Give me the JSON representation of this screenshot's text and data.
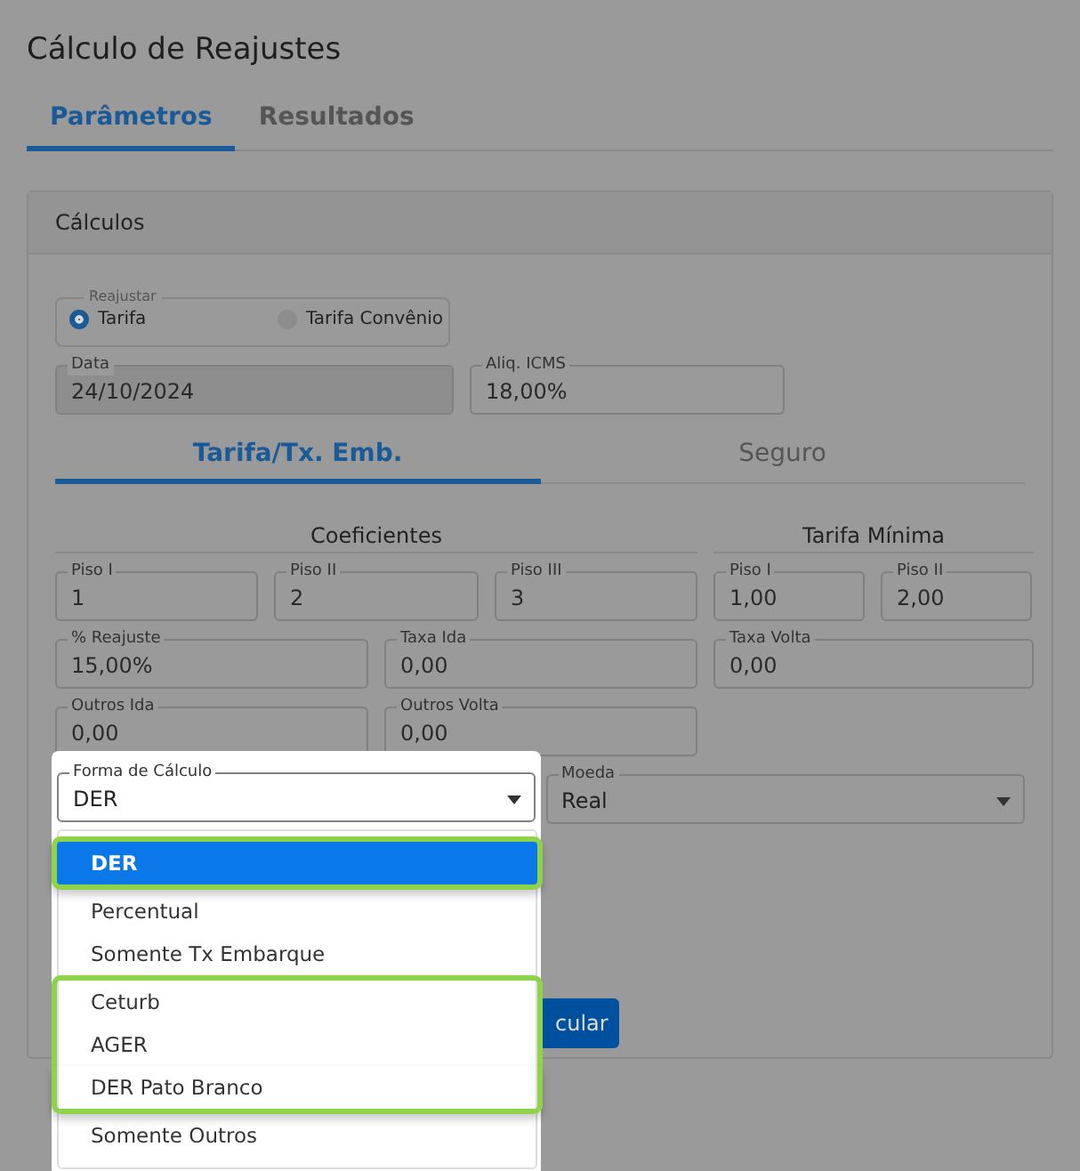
{
  "page": {
    "title": "Cálculo de Reajustes"
  },
  "tabs": [
    {
      "label": "Parâmetros",
      "selected": true
    },
    {
      "label": "Resultados",
      "selected": false
    }
  ],
  "card": {
    "title": "Cálculos"
  },
  "reajustar": {
    "legend": "Reajustar",
    "options": [
      {
        "label": "Tarifa",
        "selected": true
      },
      {
        "label": "Tarifa Convênio",
        "selected": false
      }
    ]
  },
  "top_fields": [
    {
      "label": "Data",
      "value": "24/10/2024",
      "disabled": true
    },
    {
      "label": "Aliq. ICMS",
      "value": "18,00%",
      "disabled": false
    }
  ],
  "sub_tabs": [
    {
      "label": "Tarifa/Tx. Emb.",
      "selected": true
    },
    {
      "label": "Seguro",
      "selected": false
    }
  ],
  "coeficientes": {
    "title": "Coeficientes",
    "rows": [
      [
        {
          "label": "Piso I",
          "value": "1"
        },
        {
          "label": "Piso II",
          "value": "2"
        },
        {
          "label": "Piso III",
          "value": "3"
        }
      ],
      [
        {
          "label": "% Reajuste",
          "value": "15,00%"
        },
        {
          "label": "Taxa Ida",
          "value": "0,00"
        }
      ],
      [
        {
          "label": "Outros Ida",
          "value": "0,00"
        },
        {
          "label": "Outros Volta",
          "value": "0,00"
        }
      ]
    ]
  },
  "tarifa_minima": {
    "title": "Tarifa Mínima",
    "rows": [
      [
        {
          "label": "Piso I",
          "value": "1,00"
        },
        {
          "label": "Piso II",
          "value": "2,00"
        }
      ],
      [
        {
          "label": "Taxa Volta",
          "value": "0,00"
        }
      ]
    ]
  },
  "forma_calculo": {
    "label": "Forma de Cálculo",
    "value": "DER",
    "expanded": true,
    "options": [
      {
        "label": "DER",
        "selected": true,
        "highlighted": true
      },
      {
        "label": "Percentual",
        "selected": false,
        "highlighted": false
      },
      {
        "label": "Somente Tx Embarque",
        "selected": false,
        "highlighted": false
      },
      {
        "label": "Ceturb",
        "selected": false,
        "highlighted": true
      },
      {
        "label": "AGER",
        "selected": false,
        "highlighted": true
      },
      {
        "label": "DER Pato Branco",
        "selected": false,
        "highlighted": true
      },
      {
        "label": "Somente Outros",
        "selected": false,
        "highlighted": false
      }
    ]
  },
  "moeda": {
    "label": "Moeda",
    "value": "Real"
  },
  "calcular_button": {
    "label": "cular"
  }
}
